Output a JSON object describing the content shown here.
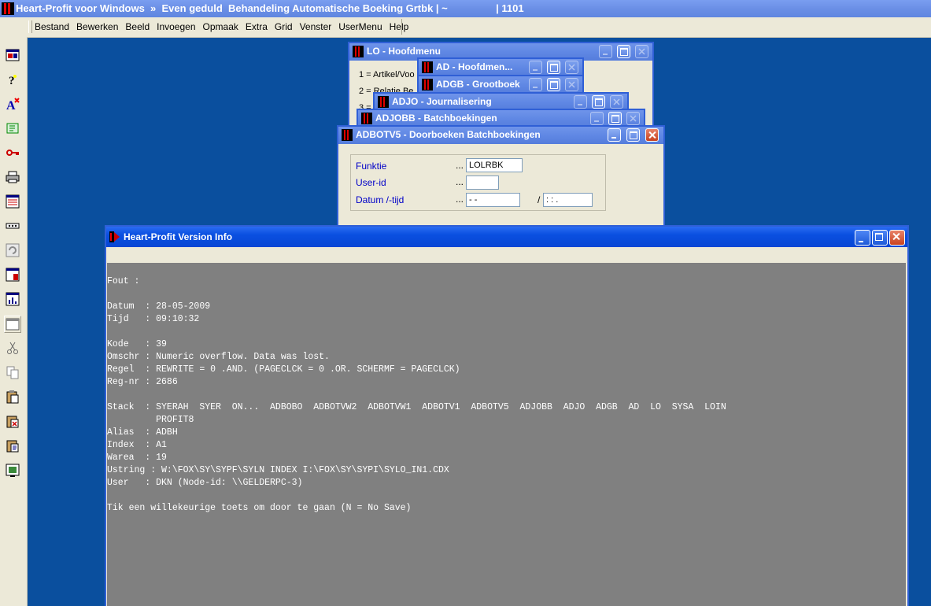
{
  "app": {
    "title": "Heart-Profit voor Windows  »  Even geduld  Behandeling Automatische Boeking Grtbk | ~                 | 1101"
  },
  "menu": [
    "Bestand",
    "Bewerken",
    "Beeld",
    "Invoegen",
    "Opmaak",
    "Extra",
    "Grid",
    "Venster",
    "UserMenu",
    "Help"
  ],
  "toolbar_icons": [
    "layout-icon",
    "help-icon",
    "font-icon",
    "tree-icon",
    "key-icon",
    "print-icon",
    "window-list-icon",
    "dots-icon",
    "refresh-icon",
    "form-icon",
    "chart-icon",
    "window-icon",
    "cut-icon",
    "copy-icon",
    "paste-icon",
    "paste-special-icon",
    "properties-icon",
    "screen-icon"
  ],
  "windows": {
    "lo": {
      "title": "LO - Hoofdmenu",
      "items": [
        "1 = Artikel/Voo",
        "2 = Relatie Be",
        "3 ="
      ]
    },
    "ad": {
      "title": "AD - Hoofdmen..."
    },
    "adgb": {
      "title": "ADGB - Grootboek"
    },
    "adjo": {
      "title": "ADJO - Journalisering"
    },
    "adjobb": {
      "title": "ADJOBB - Batchboekingen"
    },
    "adbotv5": {
      "title": "ADBOTV5 - Doorboeken Batchboekingen",
      "funktie_label": "Funktie",
      "funktie_value": "LOLRBK",
      "userid_label": "User-id",
      "userid_value": "",
      "datum_label": "Datum /-tijd",
      "datum_value": " - -",
      "tijd_sep": "/",
      "tijd_value": " : : .",
      "dots": "..."
    }
  },
  "version_info": {
    "title": "Heart-Profit Version Info",
    "lines": [
      "Fout :",
      "",
      "Datum  : 28-05-2009",
      "Tijd   : 09:10:32",
      "",
      "Kode   : 39",
      "Omschr : Numeric overflow. Data was lost.",
      "Regel  : REWRITE = 0 .AND. (PAGECLCK = 0 .OR. SCHERMF = PAGECLCK)",
      "Reg-nr : 2686",
      "",
      "Stack  : SYERAH  SYER  ON...  ADBOBO  ADBOTVW2  ADBOTVW1  ADBOTV1  ADBOTV5  ADJOBB  ADJO  ADGB  AD  LO  SYSA  LOIN",
      "         PROFIT8",
      "Alias  : ADBH",
      "Index  : A1",
      "Warea  : 19",
      "Ustring : W:\\FOX\\SY\\SYPF\\SYLN INDEX I:\\FOX\\SY\\SYPI\\SYLO_IN1.CDX",
      "User   : DKN (Node-id: \\\\GELDERPC-3)",
      "",
      "Tik een willekeurige toets om door te gaan (N = No Save)"
    ]
  }
}
